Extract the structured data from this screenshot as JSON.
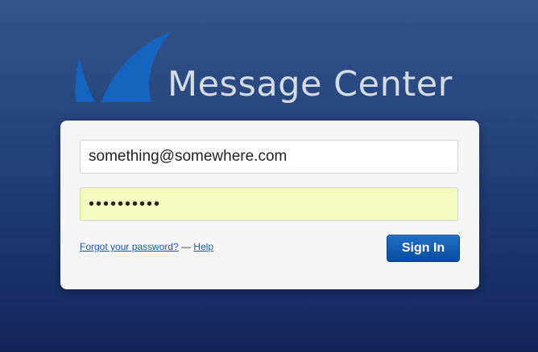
{
  "brand": {
    "title": "Message Center",
    "logo_icon": "shark-fin-logo-icon",
    "logo_color": "#1565c0"
  },
  "login": {
    "email_value": "something@somewhere.com",
    "password_value": "••••••••••",
    "forgot_password_label": "Forgot your password?",
    "separator": " — ",
    "help_label": "Help",
    "sign_in_label": "Sign In"
  },
  "colors": {
    "accent": "#0a4d9e",
    "autofill_background": "#f2fbbd",
    "link": "#1a5aa8"
  }
}
